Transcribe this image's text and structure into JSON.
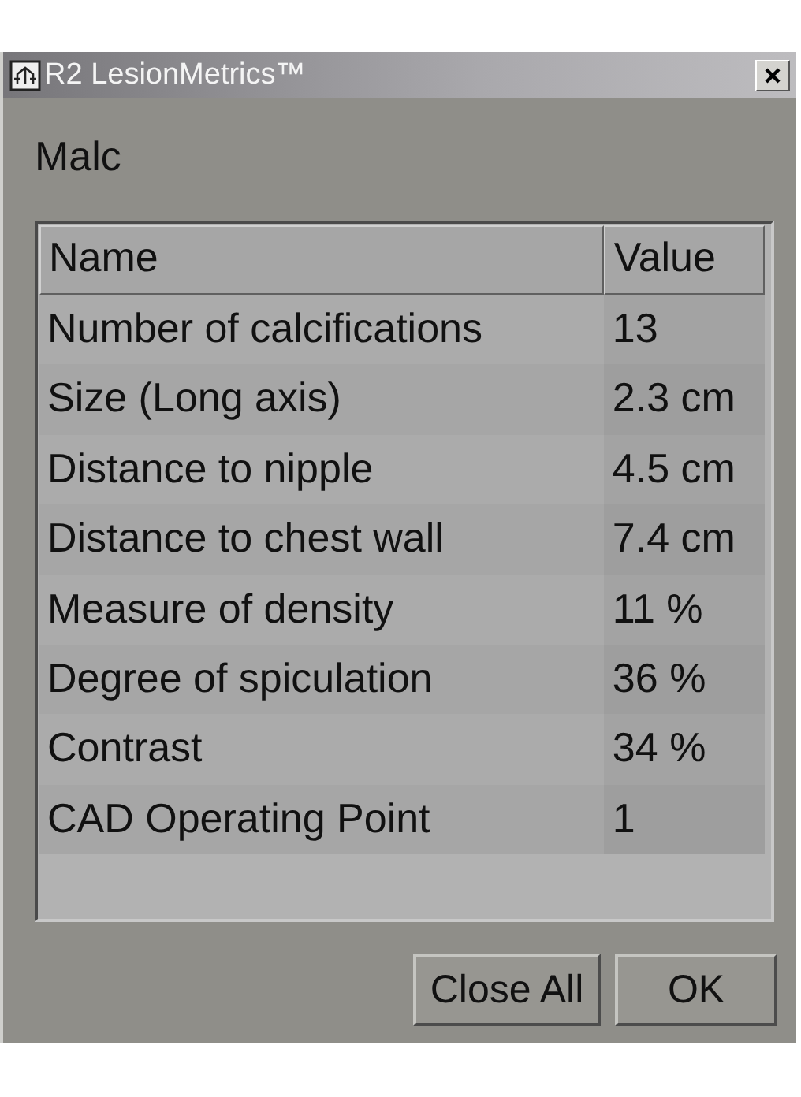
{
  "window": {
    "title": "R2 LesionMetrics™"
  },
  "heading": "Malc",
  "table": {
    "columns": [
      "Name",
      "Value"
    ],
    "rows": [
      {
        "name": "Number of calcifications",
        "value": "13"
      },
      {
        "name": "Size (Long axis)",
        "value": "2.3 cm"
      },
      {
        "name": "Distance to nipple",
        "value": "4.5 cm"
      },
      {
        "name": "Distance to chest wall",
        "value": "7.4 cm"
      },
      {
        "name": "Measure of density",
        "value": "11 %"
      },
      {
        "name": "Degree of spiculation",
        "value": "36 %"
      },
      {
        "name": "Contrast",
        "value": "34 %"
      },
      {
        "name": "CAD Operating Point",
        "value": "1"
      }
    ]
  },
  "buttons": [
    "Close All",
    "OK"
  ]
}
